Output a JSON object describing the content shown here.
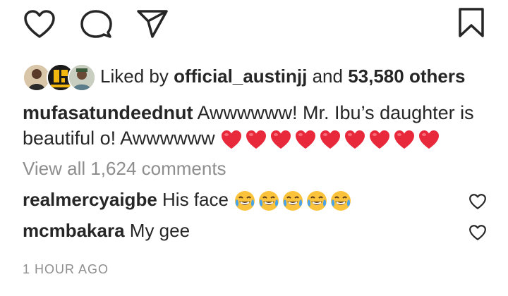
{
  "actions": {
    "like_icon": "heart-outline-icon",
    "comment_icon": "speech-bubble-icon",
    "share_icon": "paper-plane-icon",
    "save_icon": "bookmark-icon"
  },
  "likes": {
    "prefix": "Liked by",
    "user": "official_austinjj",
    "middle": "and",
    "count": "53,580 others"
  },
  "caption": {
    "username": "mufasatundeednut",
    "text": "Awwwwww! Mr. Ibu’s daughter is beautiful o! Awwwwww",
    "emoji": "red-heart",
    "emoji_count": 9
  },
  "view_all": "View all 1,624 comments",
  "comments": [
    {
      "username": "realmercyaigbe",
      "text": "His face",
      "emoji": "face-with-tears-of-joy",
      "emoji_count": 5
    },
    {
      "username": "mcmbakara",
      "text": "My gee"
    }
  ],
  "timestamp": "1 HOUR AGO",
  "colors": {
    "heart_red": "#e8293b",
    "emoji_yellow": "#fbc33c",
    "text": "#262626",
    "muted": "#8e8e8e"
  }
}
